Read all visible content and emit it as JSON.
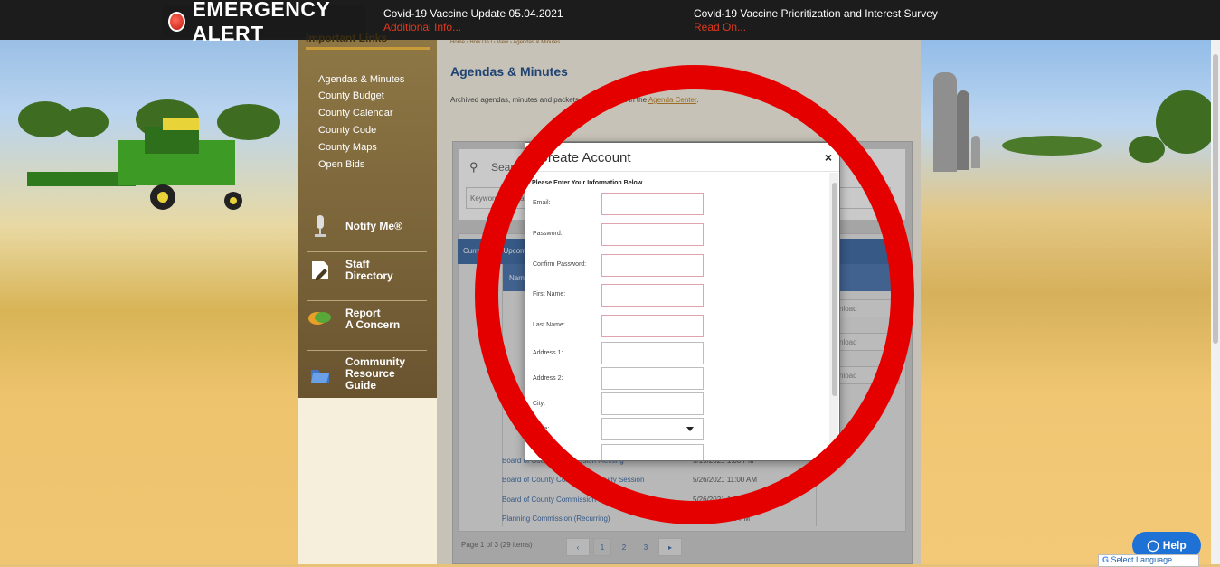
{
  "alert": {
    "title": "EMERGENCY ALERT",
    "items": [
      {
        "headline": "Covid-19 Vaccine Update 05.04.2021",
        "more": "Additional Info..."
      },
      {
        "headline": "Covid-19 Vaccine Prioritization and Interest Survey",
        "more": "Read On..."
      }
    ]
  },
  "sidebar": {
    "title": "Important Links",
    "links": [
      "Agendas & Minutes",
      "County Budget",
      "County Calendar",
      "County Code",
      "County Maps",
      "Open Bids"
    ],
    "quick": [
      {
        "label_a": "Notify Me®",
        "label_b": "",
        "label_c": "",
        "icon": "microphone-icon"
      },
      {
        "label_a": "Staff",
        "label_b": "Directory",
        "label_c": "",
        "icon": "pencil-paper-icon"
      },
      {
        "label_a": "Report",
        "label_b": "A Concern",
        "label_c": "",
        "icon": "chat-bubbles-icon"
      },
      {
        "label_a": "Community",
        "label_b": "Resource",
        "label_c": "Guide",
        "icon": "folder-icon"
      }
    ]
  },
  "main": {
    "breadcrumb": "Home › How Do I › View › Agendas & Minutes",
    "title": "Agendas & Minutes",
    "intro_pre": "Archived agendas, minutes and packets can be viewed in the",
    "intro_link": "Agenda Center",
    "intro_post": ".",
    "search_label": "Search",
    "search_placeholder": "Keyword or Phrase",
    "table_title": "Current and Upcoming",
    "col_name": "Name",
    "rows": [
      {
        "name": "Board of County Commission Meeting",
        "date": "5/19/2021 1:00 PM"
      },
      {
        "name": "Board of County Commission Study Session",
        "date": "5/26/2021 11:00 AM"
      },
      {
        "name": "Board of County Commission Meeting",
        "date": "5/26/2021 1:00 PM"
      },
      {
        "name": "Planning Commission (Recurring)",
        "date": "6/1/2021 7:00 PM"
      }
    ],
    "download_label": "Download",
    "pager_text": "Page 1 of 3 (29 items)",
    "pages": [
      "1",
      "2",
      "3"
    ]
  },
  "modal": {
    "title": "Create Account",
    "close": "×",
    "subtitle": "Please Enter Your Information Below",
    "fields": [
      {
        "label": "Email:"
      },
      {
        "label": "Password:"
      },
      {
        "label": "Confirm Password:"
      },
      {
        "label": "First Name:"
      },
      {
        "label": "Last Name:"
      },
      {
        "label": "Address 1:"
      },
      {
        "label": "Address 2:"
      },
      {
        "label": "City:"
      },
      {
        "label": "State:"
      }
    ]
  },
  "help": {
    "label": "Help"
  },
  "translate": {
    "label": "Select Language"
  },
  "colors": {
    "accent": "#1d4c8c",
    "alert": "#e50000",
    "help": "#1e72d6"
  }
}
